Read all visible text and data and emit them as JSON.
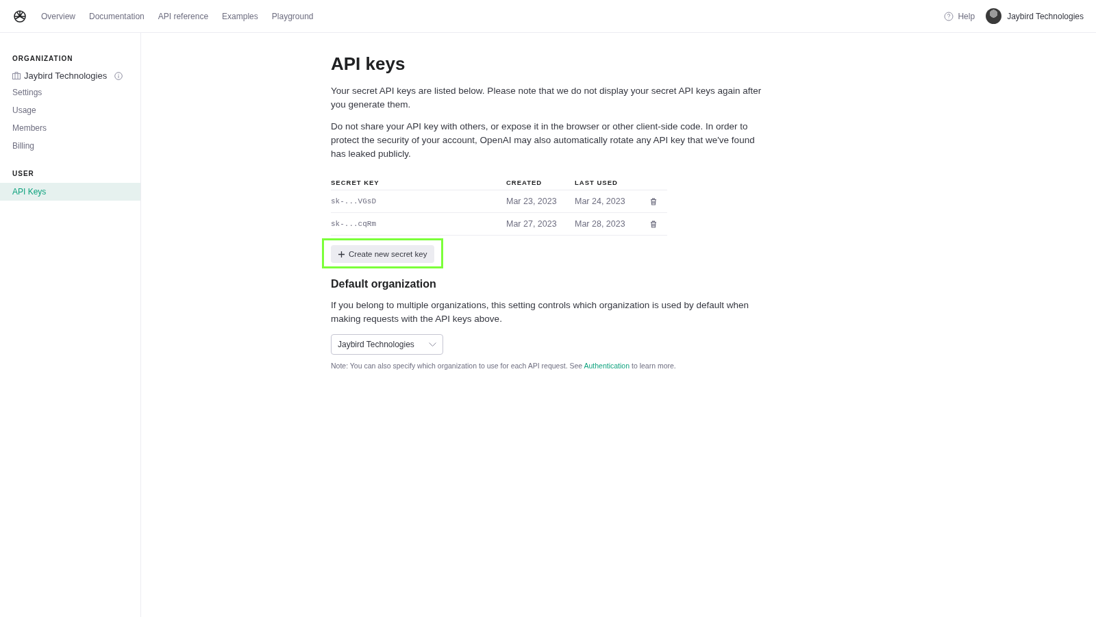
{
  "nav": {
    "links": [
      {
        "label": "Overview",
        "selected": false
      },
      {
        "label": "Documentation",
        "selected": false
      },
      {
        "label": "API reference",
        "selected": false
      },
      {
        "label": "Examples",
        "selected": false
      },
      {
        "label": "Playground",
        "selected": false
      }
    ],
    "help": "Help",
    "account": "Jaybird Technologies"
  },
  "sidebar": {
    "sections": [
      {
        "heading": "ORGANIZATION",
        "org": "Jaybird Technologies",
        "items": [
          {
            "label": "Settings",
            "selected": false
          },
          {
            "label": "Usage",
            "selected": false
          },
          {
            "label": "Members",
            "selected": false
          },
          {
            "label": "Billing",
            "selected": false
          }
        ]
      },
      {
        "heading": "USER",
        "items": [
          {
            "label": "API Keys",
            "selected": true
          }
        ]
      }
    ]
  },
  "title": "API keys",
  "paragraphs": [
    "Your secret API keys are listed below. Please note that we do not display your secret API keys again after you generate them.",
    "Do not share your API key with others, or expose it in the browser or other client-side code. In order to protect the security of your account, OpenAI may also automatically rotate any API key that we've found has leaked publicly."
  ],
  "table": {
    "columns": [
      "SECRET KEY",
      "CREATED",
      "LAST USED"
    ],
    "rows": [
      {
        "key": "sk-...VGsD",
        "created": "Mar 23, 2023",
        "last_used": "Mar 24, 2023"
      },
      {
        "key": "sk-...cqRm",
        "created": "Mar 27, 2023",
        "last_used": "Mar 28, 2023"
      }
    ]
  },
  "create_button": {
    "label": "Create new secret key",
    "highlighted": true
  },
  "default_org": {
    "heading": "Default organization",
    "text": "If you belong to multiple organizations, this setting controls which organization is used by default when making requests with the API keys above.",
    "select_value": "Jaybird Technologies",
    "note_before": "Note: You can also specify which organization to use for each API request. See ",
    "note_link": "Authentication",
    "note_after": " to learn more."
  }
}
